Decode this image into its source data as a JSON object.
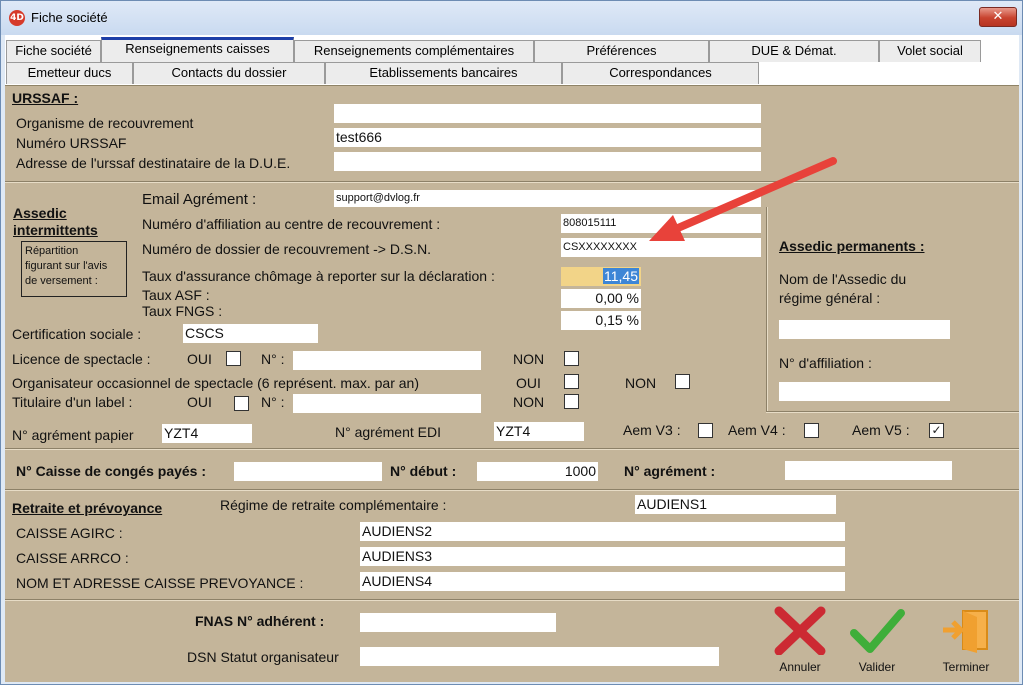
{
  "window": {
    "title": "Fiche société",
    "app_icon": "4D",
    "close": "✕"
  },
  "tabs_row1": [
    "Fiche société",
    "Renseignements caisses",
    "Renseignements complémentaires",
    "Préférences",
    "DUE & Démat.",
    "Volet social"
  ],
  "tabs_row2": [
    "Emetteur ducs",
    "Contacts du dossier",
    "Etablissements bancaires",
    "Correspondances"
  ],
  "urssaf": {
    "header": "URSSAF :",
    "org_label": "Organisme de recouvrement",
    "org_value": "",
    "num_label": "Numéro URSSAF",
    "num_value": "test666",
    "addr_label": "Adresse de l'urssaf destinataire de la D.U.E.",
    "addr_value": ""
  },
  "assedic": {
    "header_line1": "Assedic",
    "header_line2": "intermittents",
    "note_lines": [
      "Répartition",
      "figurant sur l'avis",
      "de versement :"
    ],
    "email_label": "Email Agrément :",
    "email_value": "support@dvlog.fr",
    "affil_label": "Numéro d'affiliation au centre de recouvrement :",
    "affil_value": "808015111",
    "dossier_label": "Numéro de dossier de recouvrement -> D.S.N.",
    "dossier_value": "CSXXXXXXXX",
    "taux_label": "Taux d'assurance chômage à reporter sur la déclaration :",
    "taux_value": "11,45",
    "asf_label": "Taux ASF :",
    "asf_value": "0,00 %",
    "fngs_label": "Taux FNGS :",
    "fngs_value": "0,15 %"
  },
  "assedic_perm": {
    "header": "Assedic permanents :",
    "nom_line1": "Nom de l'Assedic du",
    "nom_line2": "régime général :",
    "nom_value": "",
    "affil_label": "N° d'affiliation :",
    "affil_value": ""
  },
  "social": {
    "cert_label": "Certification sociale :",
    "cert_value": "CSCS",
    "licence_label": "Licence de spectacle :",
    "organisateur_label": "Organisateur occasionnel de spectacle (6 représent. max. par an)",
    "label_label": "Titulaire d'un label :",
    "oui": "OUI",
    "non": "NON",
    "num": "N° :",
    "licence_num_value": "",
    "label_num_value": ""
  },
  "agrement": {
    "papier_label": "N° agrément papier",
    "papier_value": "YZT4",
    "edi_label": "N° agrément EDI",
    "edi_value": "YZT4",
    "aem_v3": "Aem V3 :",
    "aem_v4": "Aem V4 :",
    "aem_v5": "Aem V5 :",
    "aem_v5_check": "✓"
  },
  "conges": {
    "caisse_label": "N° Caisse de congés payés :",
    "caisse_value": "",
    "debut_label": "N° début :",
    "debut_value": "1000",
    "agrement_label": "N° agrément :",
    "agrement_value": ""
  },
  "retraite": {
    "header": "Retraite et prévoyance",
    "regime_label": "Régime de retraite complémentaire :",
    "regime_value": "AUDIENS1",
    "agirc_label": "CAISSE AGIRC :",
    "agirc_value": "AUDIENS2",
    "arrco_label": "CAISSE ARRCO :",
    "arrco_value": "AUDIENS3",
    "prev_label": "NOM ET ADRESSE CAISSE PREVOYANCE :",
    "prev_value": "AUDIENS4"
  },
  "fnas": {
    "adherent_label": "FNAS N° adhérent :",
    "adherent_value": "",
    "dsn_label": "DSN Statut organisateur",
    "dsn_value": ""
  },
  "actions": {
    "annuler": "Annuler",
    "valider": "Valider",
    "terminer": "Terminer"
  },
  "colors": {
    "panel": "#c4b59a",
    "cancel": "#cc2a33",
    "validate": "#3fae3a",
    "exit": "#f0a030",
    "arrow": "#e8423a"
  }
}
